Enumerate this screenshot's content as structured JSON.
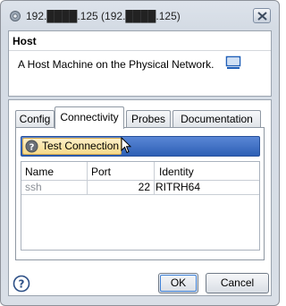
{
  "window": {
    "title": "192.████.125 (192.████.125)"
  },
  "header": {
    "title": "Host",
    "description": "A Host Machine on the Physical Network.",
    "icon": "monitor-icon"
  },
  "tabs": [
    {
      "label": "Config"
    },
    {
      "label": "Connectivity"
    },
    {
      "label": "Probes"
    },
    {
      "label": "Documentation"
    }
  ],
  "toolbar": {
    "test_connection_label": "Test Connection"
  },
  "table": {
    "columns": [
      "Name",
      "Port",
      "Identity"
    ],
    "rows": [
      {
        "name": "ssh",
        "port": "22",
        "identity": "RITRH64"
      }
    ]
  },
  "footer": {
    "ok_label": "OK",
    "cancel_label": "Cancel"
  },
  "colors": {
    "accent_bar": "#2d5fb5",
    "test_button": "#f5d98a"
  }
}
